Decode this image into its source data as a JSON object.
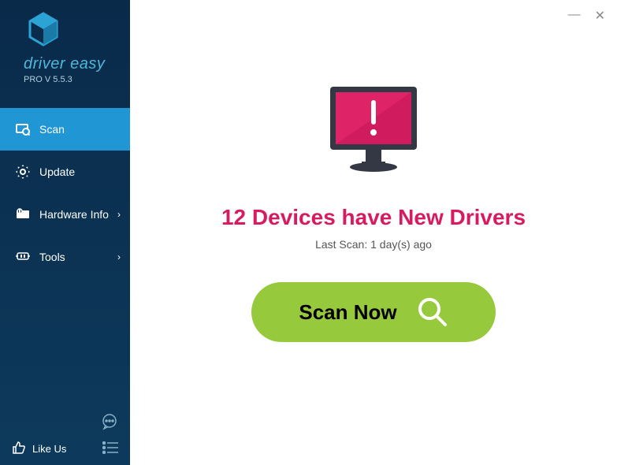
{
  "brand": {
    "name": "driver easy",
    "version": "PRO V 5.5.3"
  },
  "sidebar": {
    "items": [
      {
        "label": "Scan",
        "active": true
      },
      {
        "label": "Update"
      },
      {
        "label": "Hardware Info"
      },
      {
        "label": "Tools"
      }
    ],
    "like_us": "Like Us"
  },
  "main": {
    "headline": "12 Devices have New Drivers",
    "last_scan": "Last Scan: 1 day(s) ago",
    "scan_button": "Scan Now"
  },
  "colors": {
    "sidebar_bg": "#0d3a5c",
    "accent": "#2196d4",
    "headline": "#d81b60",
    "scan_btn": "#97c93d"
  }
}
